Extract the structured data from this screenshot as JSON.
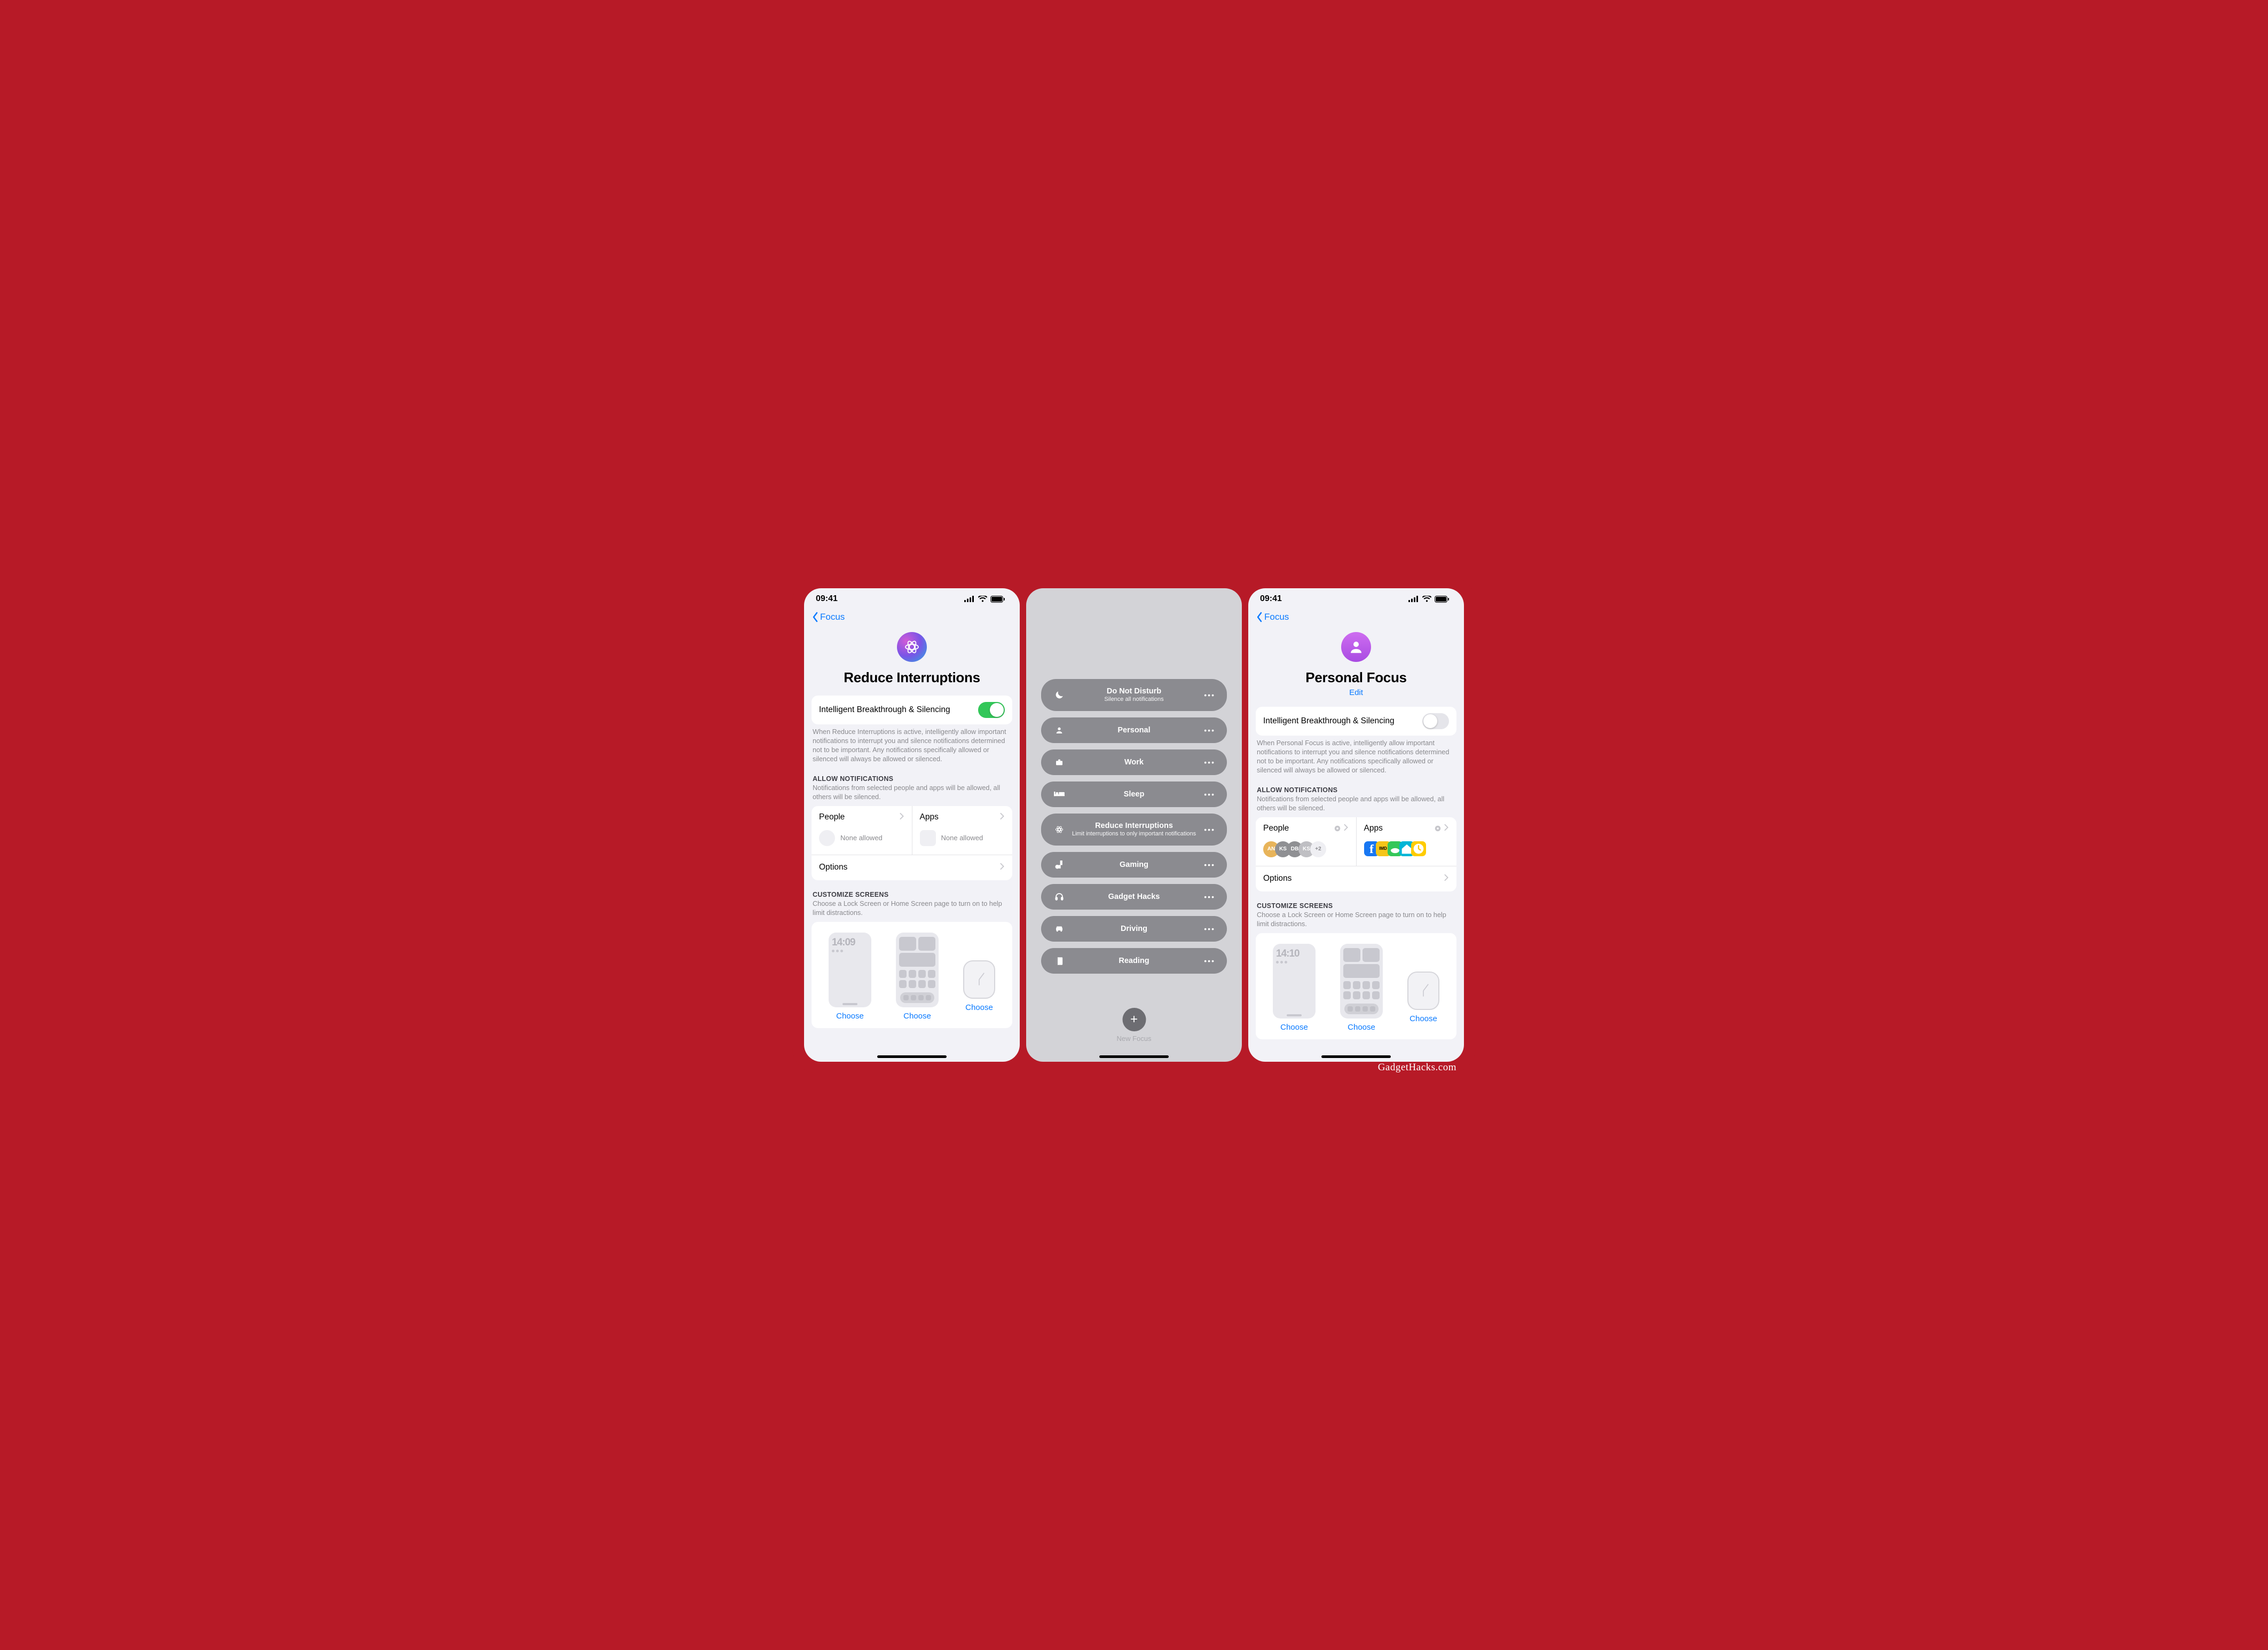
{
  "watermark": "GadgetHacks.com",
  "statusTime": "09:41",
  "left": {
    "back": "Focus",
    "title": "Reduce Interruptions",
    "toggleRow": {
      "label": "Intelligent Breakthrough & Silencing",
      "on": true
    },
    "desc": "When Reduce Interruptions is active, intelligently allow important notifications to interrupt you and silence notifications determined not to be important. Any notifications specifically allowed or silenced will always be allowed or silenced.",
    "allow": {
      "head": "ALLOW NOTIFICATIONS",
      "sub": "Notifications from selected people and apps will be allowed, all others will be silenced."
    },
    "people": {
      "title": "People",
      "status": "None allowed"
    },
    "apps": {
      "title": "Apps",
      "status": "None allowed"
    },
    "options": "Options",
    "customize": {
      "head": "CUSTOMIZE SCREENS",
      "sub": "Choose a Lock Screen or Home Screen page to turn on to help limit distractions."
    },
    "mockTime": "14:09",
    "choose": "Choose"
  },
  "middle": {
    "items": [
      {
        "icon": "moon",
        "title": "Do Not Disturb",
        "sub": "Silence all notifications"
      },
      {
        "icon": "person",
        "title": "Personal"
      },
      {
        "icon": "briefcase",
        "title": "Work"
      },
      {
        "icon": "bed",
        "title": "Sleep"
      },
      {
        "icon": "atom",
        "title": "Reduce Interruptions",
        "sub": "Limit interruptions to only important notifications"
      },
      {
        "icon": "game",
        "title": "Gaming"
      },
      {
        "icon": "headphones",
        "title": "Gadget Hacks"
      },
      {
        "icon": "car",
        "title": "Driving"
      },
      {
        "icon": "book",
        "title": "Reading"
      }
    ],
    "newFocus": "New Focus"
  },
  "right": {
    "back": "Focus",
    "title": "Personal Focus",
    "edit": "Edit",
    "toggleRow": {
      "label": "Intelligent Breakthrough & Silencing",
      "on": false
    },
    "desc": "When Personal Focus is active, intelligently allow important notifications to interrupt you and silence notifications determined not to be important. Any notifications specifically allowed or silenced will always be allowed or silenced.",
    "allow": {
      "head": "ALLOW NOTIFICATIONS",
      "sub": "Notifications from selected people and apps will be allowed, all others will be silenced."
    },
    "people": {
      "title": "People",
      "avatars": [
        "AN",
        "KS",
        "DB",
        "KS"
      ],
      "more": "+2"
    },
    "apps": {
      "title": "Apps",
      "colors": [
        "#1877F2",
        "#f5c518",
        "#34c759",
        "#00b5d6",
        "#ffcc00"
      ],
      "imdb": "IMD"
    },
    "options": "Options",
    "customize": {
      "head": "CUSTOMIZE SCREENS",
      "sub": "Choose a Lock Screen or Home Screen page to turn on to help limit distractions."
    },
    "mockTime": "14:10",
    "choose": "Choose"
  }
}
